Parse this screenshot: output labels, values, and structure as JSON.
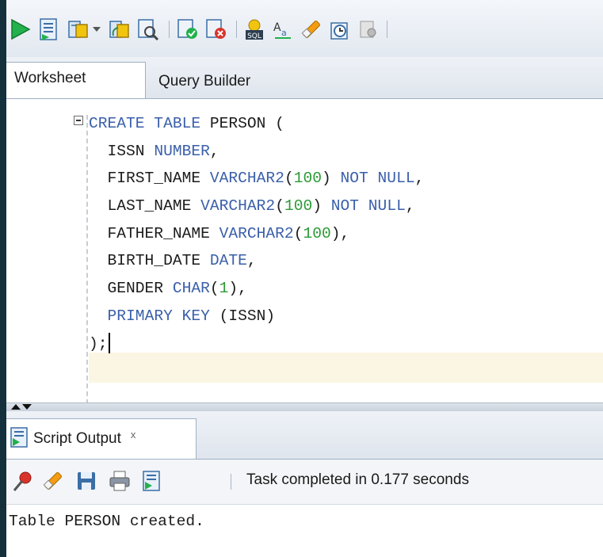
{
  "toolbar": {
    "items": [
      {
        "icon": "run-statement-icon"
      },
      {
        "icon": "run-script-icon"
      },
      {
        "icon": "commit-icon"
      },
      {
        "icon": "dropdown-arrow-icon"
      },
      {
        "icon": "rollback-icon"
      },
      {
        "icon": "explain-plan-icon"
      },
      {
        "icon": "autotrace-icon"
      },
      {
        "icon": "sql-tuning-icon"
      },
      {
        "icon": "sql-format-icon"
      },
      {
        "icon": "change-case-icon"
      },
      {
        "icon": "clear-icon"
      },
      {
        "icon": "sql-history-icon"
      },
      {
        "icon": "unshared-sql-icon"
      }
    ]
  },
  "tabs": {
    "worksheet": "Worksheet",
    "query_builder": "Query Builder"
  },
  "editor": {
    "lines": [
      [
        {
          "t": "CREATE TABLE ",
          "c": "kw"
        },
        {
          "t": "PERSON (",
          "c": "plain"
        }
      ],
      [
        {
          "t": "  ISSN ",
          "c": "plain"
        },
        {
          "t": "NUMBER",
          "c": "kw"
        },
        {
          "t": ",",
          "c": "plain"
        }
      ],
      [
        {
          "t": "  FIRST_NAME ",
          "c": "plain"
        },
        {
          "t": "VARCHAR2",
          "c": "kw"
        },
        {
          "t": "(",
          "c": "plain"
        },
        {
          "t": "100",
          "c": "num"
        },
        {
          "t": ") ",
          "c": "plain"
        },
        {
          "t": "NOT NULL",
          "c": "kw"
        },
        {
          "t": ",",
          "c": "plain"
        }
      ],
      [
        {
          "t": "  LAST_NAME ",
          "c": "plain"
        },
        {
          "t": "VARCHAR2",
          "c": "kw"
        },
        {
          "t": "(",
          "c": "plain"
        },
        {
          "t": "100",
          "c": "num"
        },
        {
          "t": ") ",
          "c": "plain"
        },
        {
          "t": "NOT NULL",
          "c": "kw"
        },
        {
          "t": ",",
          "c": "plain"
        }
      ],
      [
        {
          "t": "  FATHER_NAME ",
          "c": "plain"
        },
        {
          "t": "VARCHAR2",
          "c": "kw"
        },
        {
          "t": "(",
          "c": "plain"
        },
        {
          "t": "100",
          "c": "num"
        },
        {
          "t": "),",
          "c": "plain"
        }
      ],
      [
        {
          "t": "  BIRTH_DATE ",
          "c": "plain"
        },
        {
          "t": "DATE",
          "c": "kw"
        },
        {
          "t": ",",
          "c": "plain"
        }
      ],
      [
        {
          "t": "  GENDER ",
          "c": "plain"
        },
        {
          "t": "CHAR",
          "c": "kw"
        },
        {
          "t": "(",
          "c": "plain"
        },
        {
          "t": "1",
          "c": "num"
        },
        {
          "t": "),",
          "c": "plain"
        }
      ],
      [
        {
          "t": "  ",
          "c": "plain"
        },
        {
          "t": "PRIMARY KEY",
          "c": "kw"
        },
        {
          "t": " (ISSN)",
          "c": "plain"
        }
      ],
      [
        {
          "t": ");",
          "c": "plain"
        }
      ]
    ],
    "keyword_color": "#3a5faa",
    "number_color": "#2c9a35",
    "current_line_color": "#fbf6e3"
  },
  "output": {
    "tab_label": "Script Output",
    "tab_close": "x",
    "toolbar": [
      {
        "icon": "pin-icon"
      },
      {
        "icon": "clear-output-icon"
      },
      {
        "icon": "save-icon"
      },
      {
        "icon": "print-icon"
      },
      {
        "icon": "open-file-icon"
      }
    ],
    "status": "Task completed in 0.177 seconds",
    "text": "Table PERSON created."
  }
}
